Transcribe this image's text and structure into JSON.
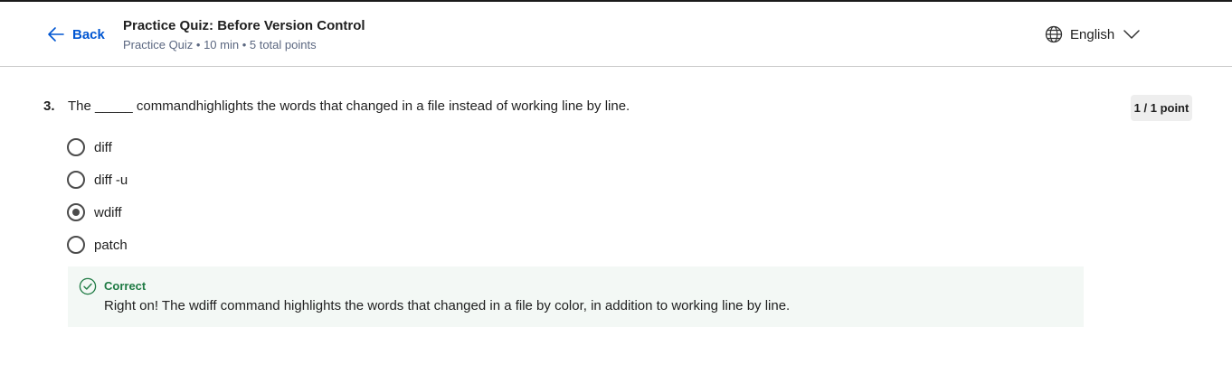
{
  "header": {
    "back_label": "Back",
    "title": "Practice Quiz: Before Version Control",
    "subtitle": "Practice Quiz • 10 min • 5 total points",
    "language": "English"
  },
  "question": {
    "number": "3.",
    "text": "The _____ commandhighlights the words that changed in a file instead of working line by line.",
    "score": "1 / 1 point",
    "options": [
      {
        "label": "diff",
        "selected": false
      },
      {
        "label": "diff -u",
        "selected": false
      },
      {
        "label": "wdiff",
        "selected": true
      },
      {
        "label": "patch",
        "selected": false
      }
    ]
  },
  "feedback": {
    "status": "Correct",
    "text": "Right on! The wdiff command highlights the words that changed in a file by color, in addition to working line by line."
  },
  "colors": {
    "link_blue": "#0056d2",
    "correct_green": "#1e7a43",
    "feedback_bg": "#f3f8f5"
  },
  "icons": [
    "arrow-left-icon",
    "globe-icon",
    "chevron-down-icon",
    "check-circle-icon"
  ]
}
